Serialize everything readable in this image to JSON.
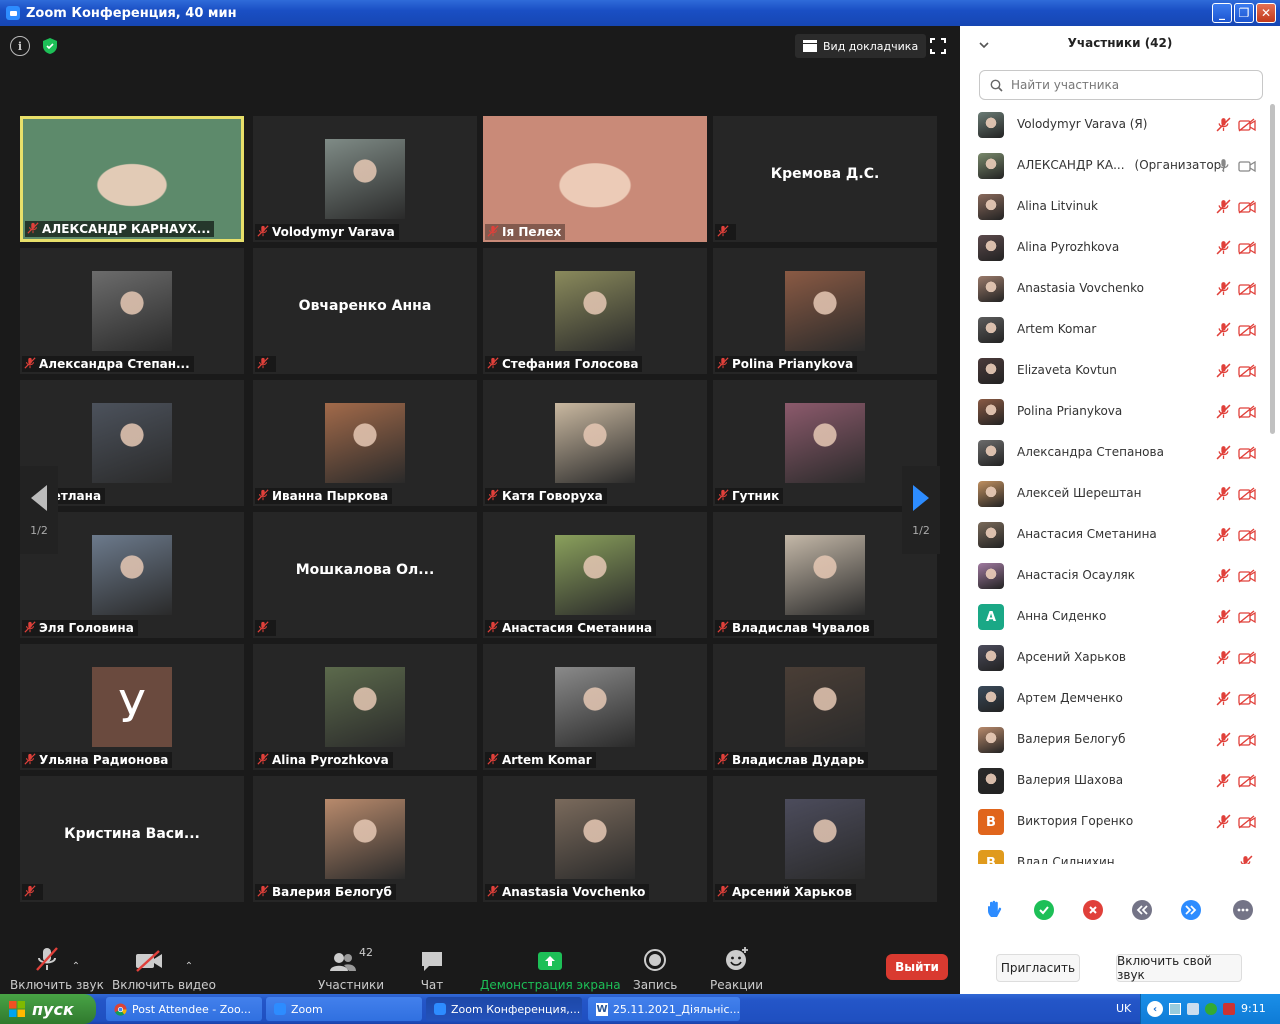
{
  "window": {
    "title": "Zoom Конференция, 40 мин",
    "minimize": "_",
    "restore": "❐",
    "close": "✕"
  },
  "video": {
    "view_button": "Вид докладчика",
    "page_left": "1/2",
    "page_right": "1/2",
    "tiles": [
      {
        "name": "АЛЕКСАНДР КАРНАУХ...",
        "type": "video",
        "active": true,
        "color": "#5d8a6b"
      },
      {
        "name": "Volodymyr Varava",
        "type": "photo",
        "color": "#7f8b86"
      },
      {
        "name": "Ія Пелех",
        "type": "video",
        "color": "#c98a78"
      },
      {
        "name": "",
        "type": "text",
        "title": "Кремова Д.С."
      },
      {
        "name": "Александра Степан...",
        "type": "photo",
        "color": "#6c6c6c"
      },
      {
        "name": "",
        "type": "text",
        "title": "Овчаренко Анна"
      },
      {
        "name": "Стефания Голосова",
        "type": "photo",
        "color": "#8a8a5c"
      },
      {
        "name": "Polina Prianykova",
        "type": "photo",
        "color": "#8a5a44"
      },
      {
        "name": "...етлана",
        "type": "photo",
        "color": "#4c525c"
      },
      {
        "name": "Иванна Пыркова",
        "type": "photo",
        "color": "#a26a4a"
      },
      {
        "name": "Катя Говоруха",
        "type": "photo",
        "color": "#c9b8a0"
      },
      {
        "name": "Гутник",
        "type": "photo",
        "color": "#8c5a6c"
      },
      {
        "name": "Эля Головина",
        "type": "photo",
        "color": "#6c7a8c"
      },
      {
        "name": "",
        "type": "text",
        "title": "Мошкалова  Ол..."
      },
      {
        "name": "Анастасия Сметанина",
        "type": "photo",
        "color": "#8aa05c"
      },
      {
        "name": "Владислав Чувалов",
        "type": "photo",
        "color": "#c4b8a8"
      },
      {
        "name": "Ульяна Радионова",
        "type": "letter",
        "letter": "У",
        "color": "#6a4a3e"
      },
      {
        "name": "Alina Pyrozhkova",
        "type": "photo",
        "color": "#5c6a4c"
      },
      {
        "name": "Artem Komar",
        "type": "photo",
        "color": "#8a8a8a"
      },
      {
        "name": "Владислав Дударь",
        "type": "photo",
        "color": "#4a3e36"
      },
      {
        "name": "",
        "type": "text",
        "title": "Кристина   Васи..."
      },
      {
        "name": "Валерия Белогуб",
        "type": "photo",
        "color": "#b88a6c"
      },
      {
        "name": "Anastasia Vovchenko",
        "type": "photo",
        "color": "#7a6a5c"
      },
      {
        "name": "Арсений Харьков",
        "type": "photo",
        "color": "#4c4c5c"
      }
    ]
  },
  "toolbar": {
    "unmute": "Включить звук",
    "start_video": "Включить видео",
    "participants": "Участники",
    "participants_count": "42",
    "chat": "Чат",
    "share": "Демонстрация экрана",
    "record": "Запись",
    "reactions": "Реакции",
    "leave": "Выйти"
  },
  "sidebar": {
    "title": "Участники (42)",
    "search_placeholder": "Найти участника",
    "invite": "Пригласить",
    "unmute_me": "Включить свой звук",
    "participants": [
      {
        "name": "Volodymyr Varava (Я)",
        "role": "",
        "color": "#6b7c75",
        "mic": "muted",
        "cam": "off"
      },
      {
        "name": "АЛЕКСАНДР КА...",
        "role": "(Организатор)",
        "color": "#7a8a6c",
        "mic": "on",
        "cam": "on"
      },
      {
        "name": "Alina Litvinuk",
        "role": "",
        "color": "#8a6a5c",
        "mic": "muted",
        "cam": "off"
      },
      {
        "name": "Alina Pyrozhkova",
        "role": "",
        "color": "#5c4a4c",
        "mic": "muted",
        "cam": "off"
      },
      {
        "name": "Anastasia Vovchenko",
        "role": "",
        "color": "#9a7a6a",
        "mic": "muted",
        "cam": "off"
      },
      {
        "name": "Artem Komar",
        "role": "",
        "color": "#5c5c5c",
        "mic": "muted",
        "cam": "off"
      },
      {
        "name": "Elizaveta Kovtun",
        "role": "",
        "color": "#4a3a3a",
        "mic": "muted",
        "cam": "off"
      },
      {
        "name": "Polina Prianykova",
        "role": "",
        "color": "#8a5a44",
        "mic": "muted",
        "cam": "off"
      },
      {
        "name": "Александра Степанова",
        "role": "",
        "color": "#6c6c6c",
        "mic": "muted",
        "cam": "off"
      },
      {
        "name": "Алексей Шерештан",
        "role": "",
        "color": "#c09060",
        "mic": "muted",
        "cam": "off"
      },
      {
        "name": "Анастасия Сметанина",
        "role": "",
        "color": "#7a6a5a",
        "mic": "muted",
        "cam": "off"
      },
      {
        "name": "Анастасія Осауляк",
        "role": "",
        "color": "#a07aa0",
        "mic": "muted",
        "cam": "off"
      },
      {
        "name": "Анна Сиденко",
        "role": "",
        "letter": "A",
        "color": "#1aa886",
        "mic": "muted",
        "cam": "off"
      },
      {
        "name": "Арсений Харьков",
        "role": "",
        "color": "#4c4c5c",
        "mic": "muted",
        "cam": "off"
      },
      {
        "name": "Артем Демченко",
        "role": "",
        "color": "#3a4a5a",
        "mic": "muted",
        "cam": "off"
      },
      {
        "name": "Валерия Белогуб",
        "role": "",
        "color": "#b88a6c",
        "mic": "muted",
        "cam": "off"
      },
      {
        "name": "Валерия Шахова",
        "role": "",
        "color": "#2a2a2a",
        "mic": "muted",
        "cam": "off"
      },
      {
        "name": "Виктория Горенко",
        "role": "",
        "letter": "B",
        "color": "#e0651c",
        "mic": "muted",
        "cam": "off"
      },
      {
        "name": "Влад Силнихин",
        "role": "",
        "letter": "B",
        "color": "#e09a1c",
        "mic": "muted",
        "cam": "none"
      }
    ]
  },
  "taskbar": {
    "start": "пуск",
    "tasks": [
      "Post Attendee - Zoo...",
      "Zoom",
      "Zoom Конференция,...",
      "25.11.2021_Діяльніс..."
    ],
    "lang": "UK",
    "time": "9:11"
  }
}
